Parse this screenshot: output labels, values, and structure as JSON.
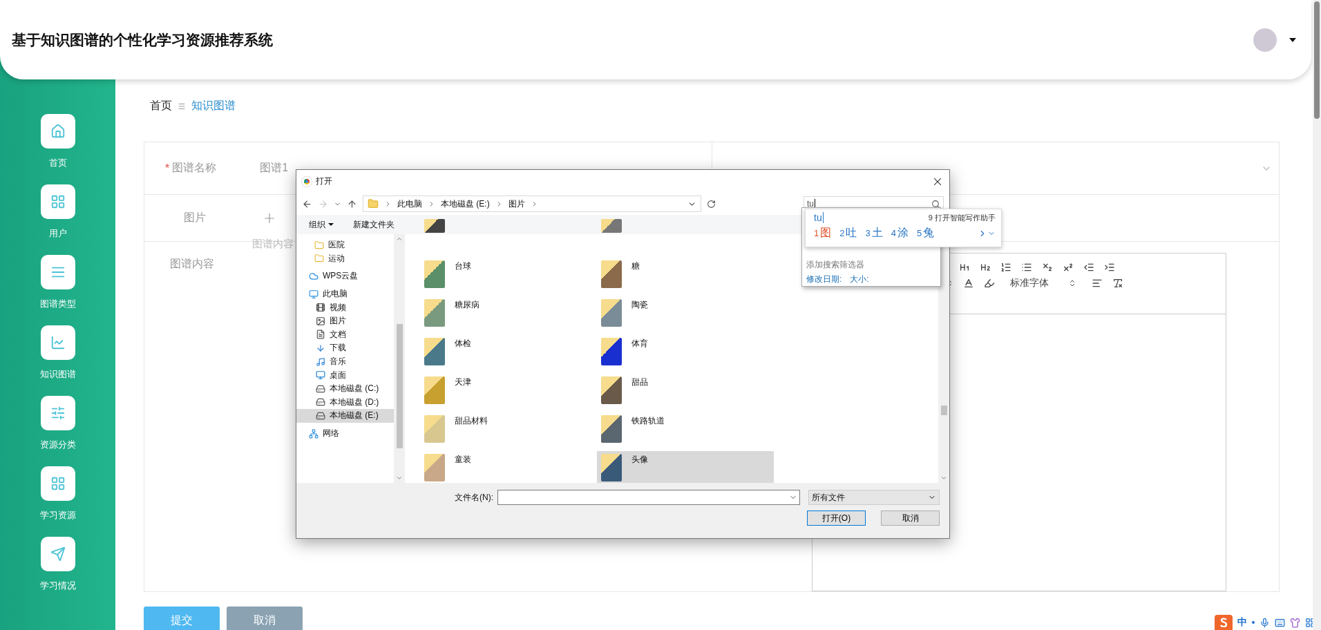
{
  "header": {
    "title": "基于知识图谱的个性化学习资源推荐系统"
  },
  "sidebar": {
    "items": [
      {
        "label": "首页"
      },
      {
        "label": "用户"
      },
      {
        "label": "图谱类型"
      },
      {
        "label": "知识图谱"
      },
      {
        "label": "资源分类"
      },
      {
        "label": "学习资源"
      },
      {
        "label": "学习情况"
      }
    ]
  },
  "breadcrumb": [
    {
      "label": "首页",
      "current": false
    },
    {
      "label": "知识图谱",
      "current": true
    }
  ],
  "form": {
    "name_label": "图谱名称",
    "name_required_mark": "*",
    "name_value": "图谱1",
    "image_label": "图片",
    "image_hint": "图谱内容",
    "content_label": "图谱内容",
    "editor_font": "标准字体"
  },
  "actions": [
    {
      "label": "提交",
      "kind": "primary"
    },
    {
      "label": "取消",
      "kind": "secondary"
    }
  ],
  "dialog": {
    "title": "打开",
    "path": [
      "此电脑",
      "本地磁盘 (E:)",
      "图片"
    ],
    "search_value": "tu",
    "toolbar": [
      {
        "label": "组织",
        "menu": true
      },
      {
        "label": "新建文件夹",
        "menu": false
      }
    ],
    "nav": [
      {
        "label": "医院",
        "kind": "folder",
        "selected": false
      },
      {
        "label": "运动",
        "kind": "folder",
        "selected": false
      },
      {
        "label": "WPS云盘",
        "kind": "cloud",
        "selected": false
      },
      {
        "label": "此电脑",
        "kind": "pc",
        "selected": false,
        "children": [
          {
            "label": "视频",
            "kind": "video",
            "selected": false
          },
          {
            "label": "图片",
            "kind": "pictures",
            "selected": false
          },
          {
            "label": "文档",
            "kind": "documents",
            "selected": false
          },
          {
            "label": "下载",
            "kind": "downloads",
            "selected": false
          },
          {
            "label": "音乐",
            "kind": "music",
            "selected": false
          },
          {
            "label": "桌面",
            "kind": "desktop",
            "selected": false
          },
          {
            "label": "本地磁盘 (C:)",
            "kind": "drive",
            "selected": false
          },
          {
            "label": "本地磁盘 (D:)",
            "kind": "drive",
            "selected": false
          },
          {
            "label": "本地磁盘 (E:)",
            "kind": "drive",
            "selected": true
          }
        ]
      },
      {
        "label": "网络",
        "kind": "network",
        "selected": false
      }
    ],
    "files": [
      {
        "name": "台球",
        "selected": false
      },
      {
        "name": "糖",
        "selected": false
      },
      {
        "name": "糖尿病",
        "selected": false
      },
      {
        "name": "陶瓷",
        "selected": false
      },
      {
        "name": "体检",
        "selected": false
      },
      {
        "name": "体育",
        "selected": false
      },
      {
        "name": "天津",
        "selected": false
      },
      {
        "name": "甜品",
        "selected": false
      },
      {
        "name": "甜品材料",
        "selected": false
      },
      {
        "name": "铁路轨道",
        "selected": false
      },
      {
        "name": "童装",
        "selected": false
      },
      {
        "name": "头像",
        "selected": true
      }
    ],
    "filename_label": "文件名(N):",
    "filetype": "所有文件",
    "buttons": [
      {
        "label": "打开(O)",
        "kind": "default"
      },
      {
        "label": "取消",
        "kind": "normal"
      }
    ]
  },
  "search_dropdown": {
    "add_filter": "添加搜索筛选器",
    "filters": [
      "修改日期:",
      "大小:"
    ]
  },
  "ime": {
    "composition": "tu",
    "assistant": "9 打开智能写作助手",
    "candidates": [
      {
        "num": "1",
        "char": "图",
        "selected": true
      },
      {
        "num": "2",
        "char": "吐",
        "selected": false
      },
      {
        "num": "3",
        "char": "土",
        "selected": false
      },
      {
        "num": "4",
        "char": "涂",
        "selected": false
      },
      {
        "num": "5",
        "char": "兔",
        "selected": false
      }
    ]
  },
  "ime_bar": {
    "mode": "中"
  }
}
